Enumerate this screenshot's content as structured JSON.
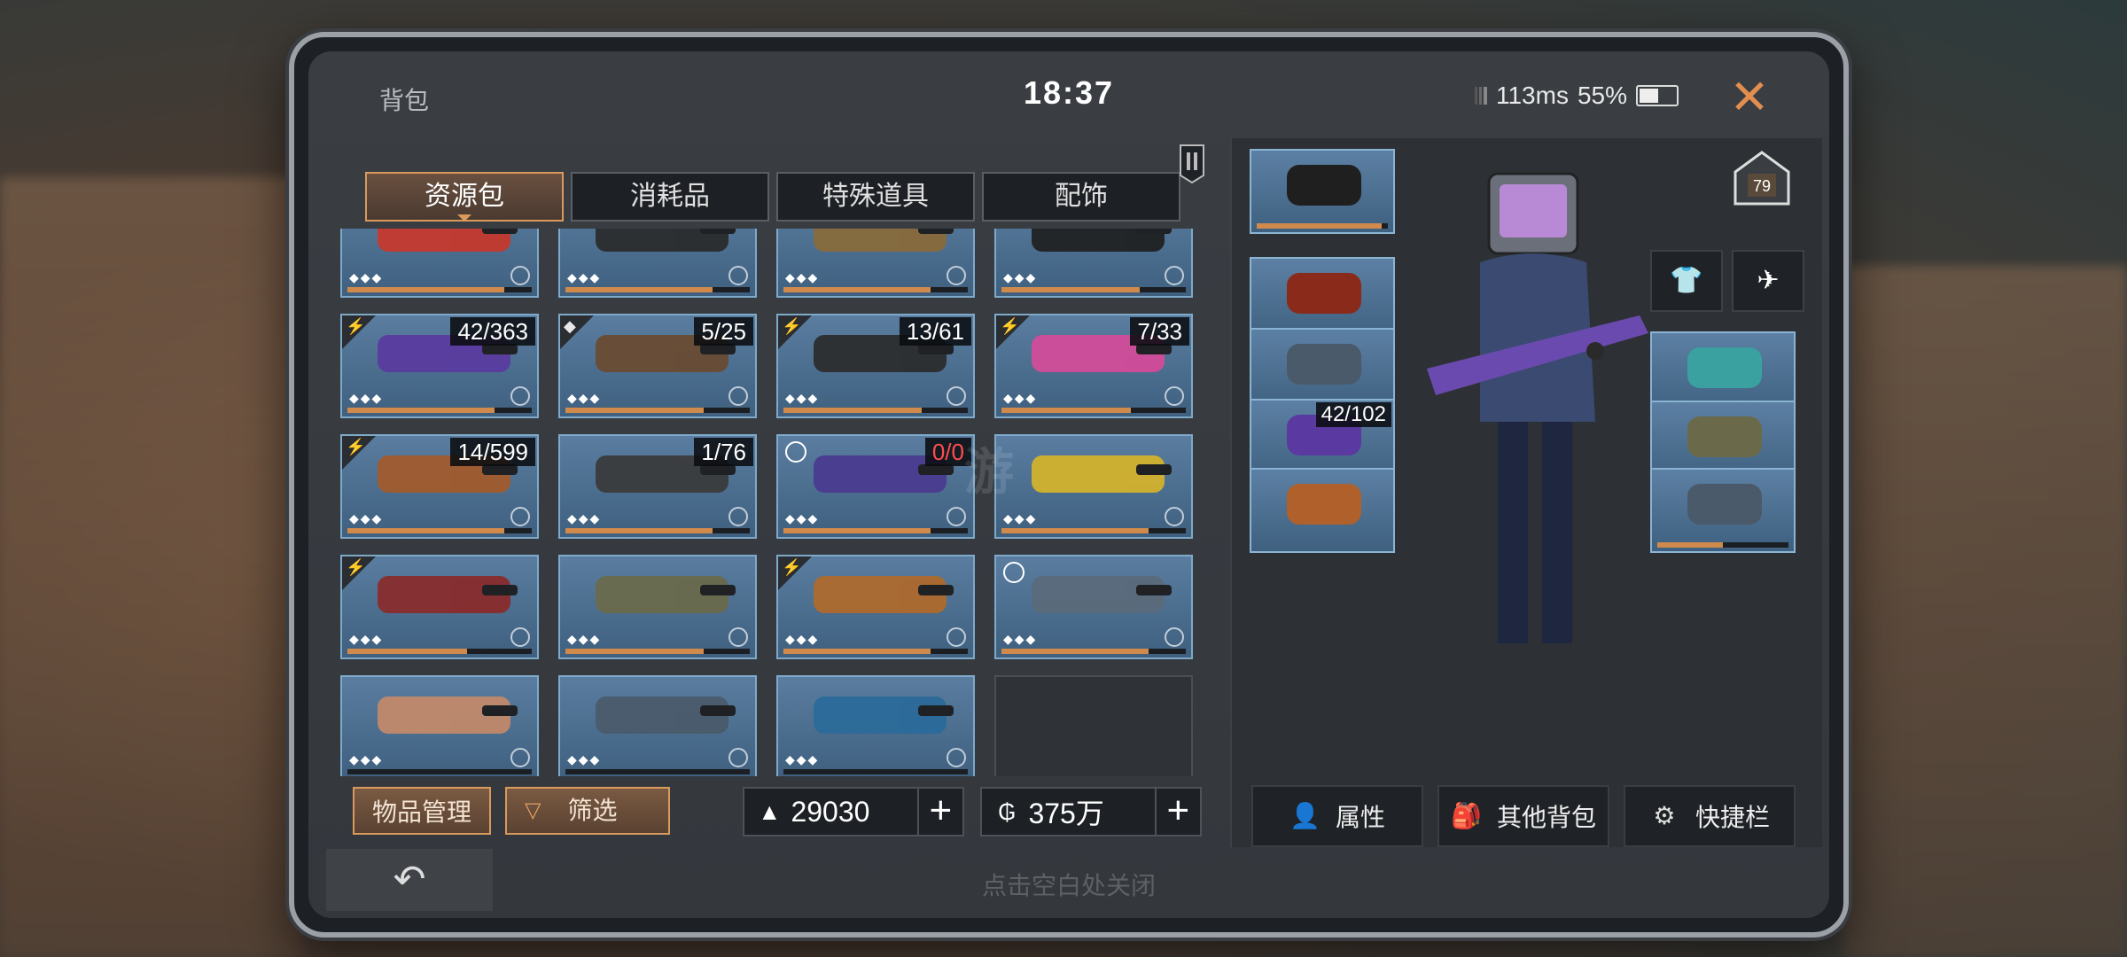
{
  "header": {
    "title": "背包",
    "time": "18:37",
    "latency": "113ms",
    "battery": "55%",
    "battery_level": 0.55
  },
  "tabs": [
    {
      "label": "资源包",
      "active": true
    },
    {
      "label": "消耗品",
      "active": false
    },
    {
      "label": "特殊道具",
      "active": false
    },
    {
      "label": "配饰",
      "active": false
    }
  ],
  "grid": {
    "rows": [
      [
        {
          "name": "red-sniper-rifle",
          "count": "",
          "color": "#c8372b",
          "progress": 0.85
        },
        {
          "name": "black-assault-rifle",
          "count": "",
          "color": "#2a2a2a",
          "progress": 0.8
        },
        {
          "name": "gold-assault-rifle",
          "count": "",
          "color": "#8a6a3a",
          "progress": 0.8
        },
        {
          "name": "tactical-rifle",
          "count": "",
          "color": "#1f1f1f",
          "progress": 0.75
        }
      ],
      [
        {
          "name": "galaxy-rifle",
          "count": "42/363",
          "color": "#5a3aa0",
          "progress": 0.8,
          "corner": "orange"
        },
        {
          "name": "grenade-launcher",
          "count": "5/25",
          "color": "#6a4a30",
          "progress": 0.75,
          "corner": "diamond"
        },
        {
          "name": "drum-shotgun",
          "count": "13/61",
          "color": "#2b2b2b",
          "progress": 0.75,
          "corner": "orange"
        },
        {
          "name": "pink-wings",
          "count": "7/33",
          "color": "#d64b9a",
          "progress": 0.7,
          "corner": "purple"
        }
      ],
      [
        {
          "name": "flame-rifle",
          "count": "14/599",
          "color": "#a45a2a",
          "progress": 0.85,
          "corner": "orange"
        },
        {
          "name": "compound-bow",
          "count": "1/76",
          "color": "#3a3a3a",
          "progress": 0.8
        },
        {
          "name": "purple-sniper",
          "count": "0/0",
          "count_red": true,
          "color": "#4a3a90",
          "progress": 0.8,
          "timer": true
        },
        {
          "name": "yellow-jetpack",
          "count": "",
          "color": "#d6b42a",
          "progress": 0.8
        }
      ],
      [
        {
          "name": "chainsaw-blade",
          "count": "",
          "color": "#8a2a2a",
          "progress": 0.65,
          "corner": "cyan"
        },
        {
          "name": "hunting-knife",
          "count": "",
          "color": "#6a6a4a",
          "progress": 0.75
        },
        {
          "name": "orange-rifle",
          "count": "",
          "color": "#b06a2a",
          "progress": 0.8,
          "corner": "orange"
        },
        {
          "name": "armor-vest",
          "count": "",
          "color": "#5a6a7a",
          "progress": 0.8,
          "timer": true
        }
      ],
      [
        {
          "name": "character-portrait",
          "count": "",
          "color": "#c48a6a",
          "progress": 0
        },
        {
          "name": "mech-drone",
          "count": "",
          "color": "#4a5a6a",
          "progress": 0
        },
        {
          "name": "potion-bottle",
          "count": "",
          "color": "#2a6a9a",
          "progress": 0
        },
        {
          "name": "empty-slot",
          "empty": true
        }
      ]
    ]
  },
  "bottom": {
    "manage_label": "物品管理",
    "filter_label": "筛选",
    "currency1": "29030",
    "currency2": "375万"
  },
  "equipment": {
    "left_slots": [
      {
        "name": "mask-slot",
        "count": "",
        "color": "#1f1f1f",
        "progress": 0.95
      },
      {
        "name": "helmet-slot",
        "count": "",
        "color": "#8a2a1a",
        "progress": 0
      },
      {
        "name": "armor-slot",
        "count": "",
        "color": "#4a5a6a",
        "progress": 0
      },
      {
        "name": "weapon-slot",
        "count": "42/102",
        "color": "#5a3aa0",
        "progress": 0.8
      },
      {
        "name": "pendant-slot",
        "count": "",
        "color": "#b0602a",
        "progress": 0
      }
    ],
    "right_slots": [
      {
        "name": "ring-slot",
        "count": "",
        "color": "#3aa0a0",
        "progress": 0
      },
      {
        "name": "blade-slot",
        "count": "",
        "color": "#6a6a4a",
        "progress": 0.85
      },
      {
        "name": "mech-slot",
        "count": "",
        "color": "#4a5a6a",
        "progress": 0.5
      }
    ],
    "level": "79"
  },
  "actions": [
    {
      "label": "属性",
      "icon": "person-icon"
    },
    {
      "label": "其他背包",
      "icon": "backpack-icon"
    },
    {
      "label": "快捷栏",
      "icon": "shortcut-icon"
    }
  ],
  "footer": {
    "hint": "点击空白处关闭"
  }
}
